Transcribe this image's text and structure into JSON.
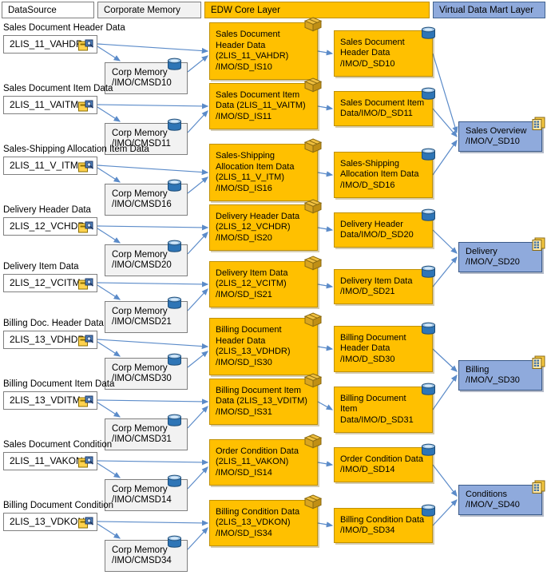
{
  "header": {
    "columns": [
      {
        "id": "datasource",
        "label": "DataSource"
      },
      {
        "id": "corporate_memory",
        "label": "Corporate Memory"
      },
      {
        "id": "edw_core",
        "label": "EDW Core Layer"
      },
      {
        "id": "virtual_data_mart",
        "label": "Virtual Data Mart Layer"
      }
    ]
  },
  "colors": {
    "edw_fill": "#ffc000",
    "edw_border": "#bf9000",
    "vdm_fill": "#8faadc",
    "vdm_border": "#3b5a88",
    "corp_memory_fill": "#f2f2f2",
    "datasource_fill": "#ffffff",
    "arrow": "#5b8bc9"
  },
  "rows": [
    {
      "caption": "Sales Document Header Data",
      "datasource": "2LIS_11_VAHDR",
      "corp_memory": [
        "Corp Memory",
        "/IMO/CMSD10"
      ],
      "infosource": [
        "Sales Document",
        "Header Data",
        "(2LIS_11_VAHDR)",
        "/IMO/SD_IS10"
      ],
      "dso": [
        "Sales Document",
        "Header Data",
        "/IMO/D_SD10"
      ]
    },
    {
      "caption": "Sales Document Item Data",
      "datasource": "2LIS_11_VAITM",
      "corp_memory": [
        "Corp Memory",
        "/IMO/CMSD11"
      ],
      "infosource": [
        "Sales Document Item",
        "Data (2LIS_11_VAITM)",
        "/IMO/SD_IS11"
      ],
      "dso": [
        "Sales Document Item",
        "Data/IMO/D_SD11"
      ]
    },
    {
      "caption": "Sales-Shipping Allocation Item Data",
      "datasource": "2LIS_11_V_ITM",
      "corp_memory": [
        "Corp Memory",
        "/IMO/CMSD16"
      ],
      "infosource": [
        "Sales-Shipping",
        "Allocation Item Data",
        "(2LIS_11_V_ITM)",
        "/IMO/SD_IS16"
      ],
      "dso": [
        "Sales-Shipping",
        "Allocation Item Data",
        "/IMO/D_SD16"
      ]
    },
    {
      "caption": "Delivery Header Data",
      "datasource": "2LIS_12_VCHDR",
      "corp_memory": [
        "Corp Memory",
        "/IMO/CMSD20"
      ],
      "infosource": [
        "Delivery Header Data",
        "(2LIS_12_VCHDR)",
        "/IMO/SD_IS20"
      ],
      "dso": [
        "Delivery Header",
        "Data/IMO/D_SD20"
      ]
    },
    {
      "caption": "Delivery Item Data",
      "datasource": "2LIS_12_VCITM",
      "corp_memory": [
        "Corp Memory",
        "/IMO/CMSD21"
      ],
      "infosource": [
        "Delivery Item Data",
        "(2LIS_12_VCITM)",
        "/IMO/SD_IS21"
      ],
      "dso": [
        "Delivery Item Data",
        "/IMO/D_SD21"
      ]
    },
    {
      "caption": "Billing Doc. Header Data",
      "datasource": "2LIS_13_VDHDR",
      "corp_memory": [
        "Corp Memory",
        "/IMO/CMSD30"
      ],
      "infosource": [
        "Billing Document",
        "Header Data",
        "(2LIS_13_VDHDR)",
        "/IMO/SD_IS30"
      ],
      "dso": [
        "Billing Document",
        "Header Data",
        "/IMO/D_SD30"
      ]
    },
    {
      "caption": "Billing Document Item Data",
      "datasource": "2LIS_13_VDITM",
      "corp_memory": [
        "Corp Memory",
        "/IMO/CMSD31"
      ],
      "infosource": [
        "Billing Document Item",
        "Data (2LIS_13_VDITM)",
        "/IMO/SD_IS31"
      ],
      "dso": [
        "Billing Document",
        "Item",
        "Data/IMO/D_SD31"
      ]
    },
    {
      "caption": "Sales Document Condition",
      "datasource": "2LIS_11_VAKON",
      "corp_memory": [
        "Corp Memory",
        "/IMO/CMSD14"
      ],
      "infosource": [
        "Order Condition Data",
        "(2LIS_11_VAKON)",
        "/IMO/SD_IS14"
      ],
      "dso": [
        "Order Condition Data",
        "/IMO/D_SD14"
      ]
    },
    {
      "caption": "Billing Document Condition",
      "datasource": "2LIS_13_VDKON",
      "corp_memory": [
        "Corp Memory",
        "/IMO/CMSD34"
      ],
      "infosource": [
        "Billing Condition Data",
        "(2LIS_13_VDKON)",
        "/IMO/SD_IS34"
      ],
      "dso": [
        "Billing Condition Data",
        "/IMO/D_SD34"
      ]
    }
  ],
  "marts": [
    {
      "id": "sales_overview",
      "lines": [
        "Sales Overview",
        "/IMO/V_SD10"
      ]
    },
    {
      "id": "delivery",
      "lines": [
        "Delivery",
        "/IMO/V_SD20"
      ]
    },
    {
      "id": "billing",
      "lines": [
        "Billing",
        "/IMO/V_SD30"
      ]
    },
    {
      "id": "conditions",
      "lines": [
        "Conditions",
        "/IMO/V_SD40"
      ]
    }
  ],
  "icons": {
    "datasource": "datasource-icon",
    "infosource": "package-icon",
    "dso": "cylinder-icon",
    "corp_memory": "cylinder-icon",
    "mart": "multiprovider-icon"
  }
}
